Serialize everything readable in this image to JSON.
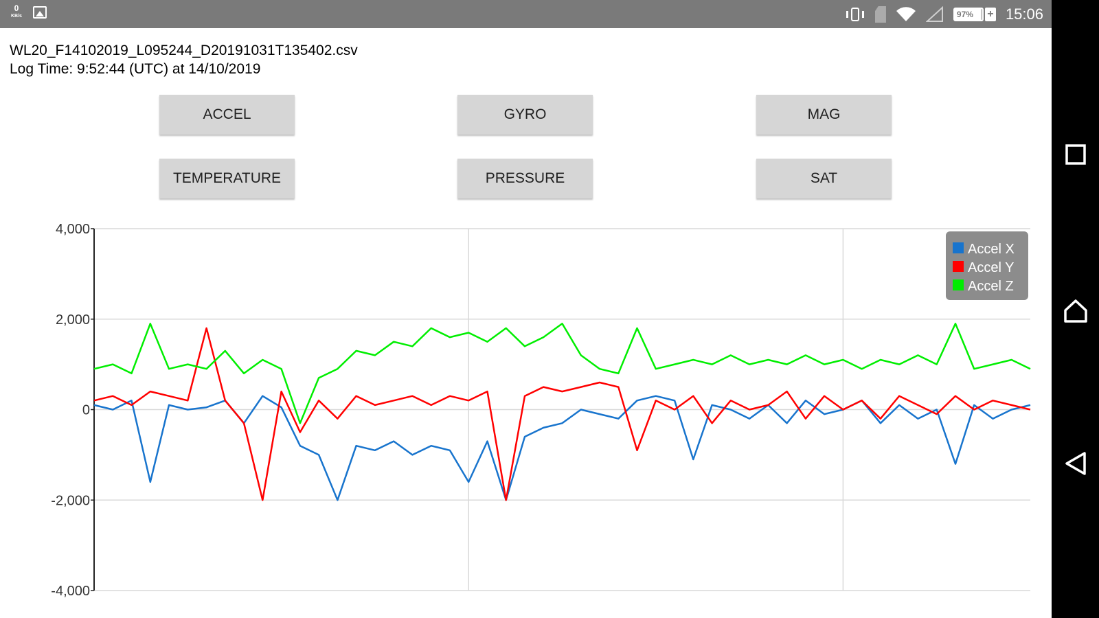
{
  "status_bar": {
    "net_speed": "0",
    "net_unit": "KB/s",
    "battery_percent": "97%",
    "battery_level": 0.97,
    "time": "15:06"
  },
  "file": {
    "name": "WL20_F14102019_L095244_D20191031T135402.csv",
    "log_time": "Log Time: 9:52:44 (UTC) at 14/10/2019"
  },
  "buttons": {
    "accel": "ACCEL",
    "gyro": "GYRO",
    "mag": "MAG",
    "temperature": "TEMPERATURE",
    "pressure": "PRESSURE",
    "sat": "SAT"
  },
  "nav": {
    "recents_icon": "square-icon",
    "home_icon": "home-icon",
    "back_icon": "triangle-back-icon"
  },
  "chart_data": {
    "type": "line",
    "title": "",
    "xlabel": "",
    "ylabel": "",
    "ylim": [
      -4000,
      4000
    ],
    "yticks": [
      "4,000",
      "2,000",
      "0",
      "-2,000",
      "-4,000"
    ],
    "ytick_values": [
      4000,
      2000,
      0,
      -2000,
      -4000
    ],
    "vertical_gridlines": 2,
    "grid": true,
    "legend_position": "top-right",
    "x": [
      0,
      0.5,
      1,
      1.5,
      2,
      2.5,
      3,
      3.5,
      4,
      4.5,
      5,
      5.5,
      6,
      6.5,
      7,
      7.5,
      8,
      8.5,
      9,
      9.5,
      10,
      10.5,
      11,
      11.5,
      12,
      12.5,
      13,
      13.5,
      14,
      14.5,
      15,
      15.5,
      16,
      16.5,
      17,
      17.5,
      18,
      18.5,
      19,
      19.5,
      20,
      20.5,
      21,
      21.5,
      22,
      22.5,
      23,
      23.5,
      24,
      24.5,
      25
    ],
    "series": [
      {
        "name": "Accel X",
        "color": "#1874cd",
        "values": [
          100,
          0,
          200,
          -1600,
          100,
          0,
          50,
          200,
          -300,
          300,
          50,
          -800,
          -1000,
          -2000,
          -800,
          -900,
          -700,
          -1000,
          -800,
          -900,
          -1600,
          -700,
          -2000,
          -600,
          -400,
          -300,
          0,
          -100,
          -200,
          200,
          300,
          200,
          -1100,
          100,
          0,
          -200,
          100,
          -300,
          200,
          -100,
          0,
          200,
          -300,
          100,
          -200,
          0,
          -1200,
          100,
          -200,
          0,
          100
        ]
      },
      {
        "name": "Accel Y",
        "color": "#ff0000",
        "values": [
          200,
          300,
          100,
          400,
          300,
          200,
          1800,
          200,
          -300,
          -2000,
          400,
          -500,
          200,
          -200,
          300,
          100,
          200,
          300,
          100,
          300,
          200,
          400,
          -2000,
          300,
          500,
          400,
          500,
          600,
          500,
          -900,
          200,
          0,
          300,
          -300,
          200,
          0,
          100,
          400,
          -200,
          300,
          0,
          200,
          -200,
          300,
          100,
          -100,
          300,
          0,
          200,
          100,
          0
        ]
      },
      {
        "name": "Accel Z",
        "color": "#00ee00",
        "values": [
          900,
          1000,
          800,
          1900,
          900,
          1000,
          900,
          1300,
          800,
          1100,
          900,
          -300,
          700,
          900,
          1300,
          1200,
          1500,
          1400,
          1800,
          1600,
          1700,
          1500,
          1800,
          1400,
          1600,
          1900,
          1200,
          900,
          800,
          1800,
          900,
          1000,
          1100,
          1000,
          1200,
          1000,
          1100,
          1000,
          1200,
          1000,
          1100,
          900,
          1100,
          1000,
          1200,
          1000,
          1900,
          900,
          1000,
          1100,
          900
        ]
      }
    ]
  }
}
